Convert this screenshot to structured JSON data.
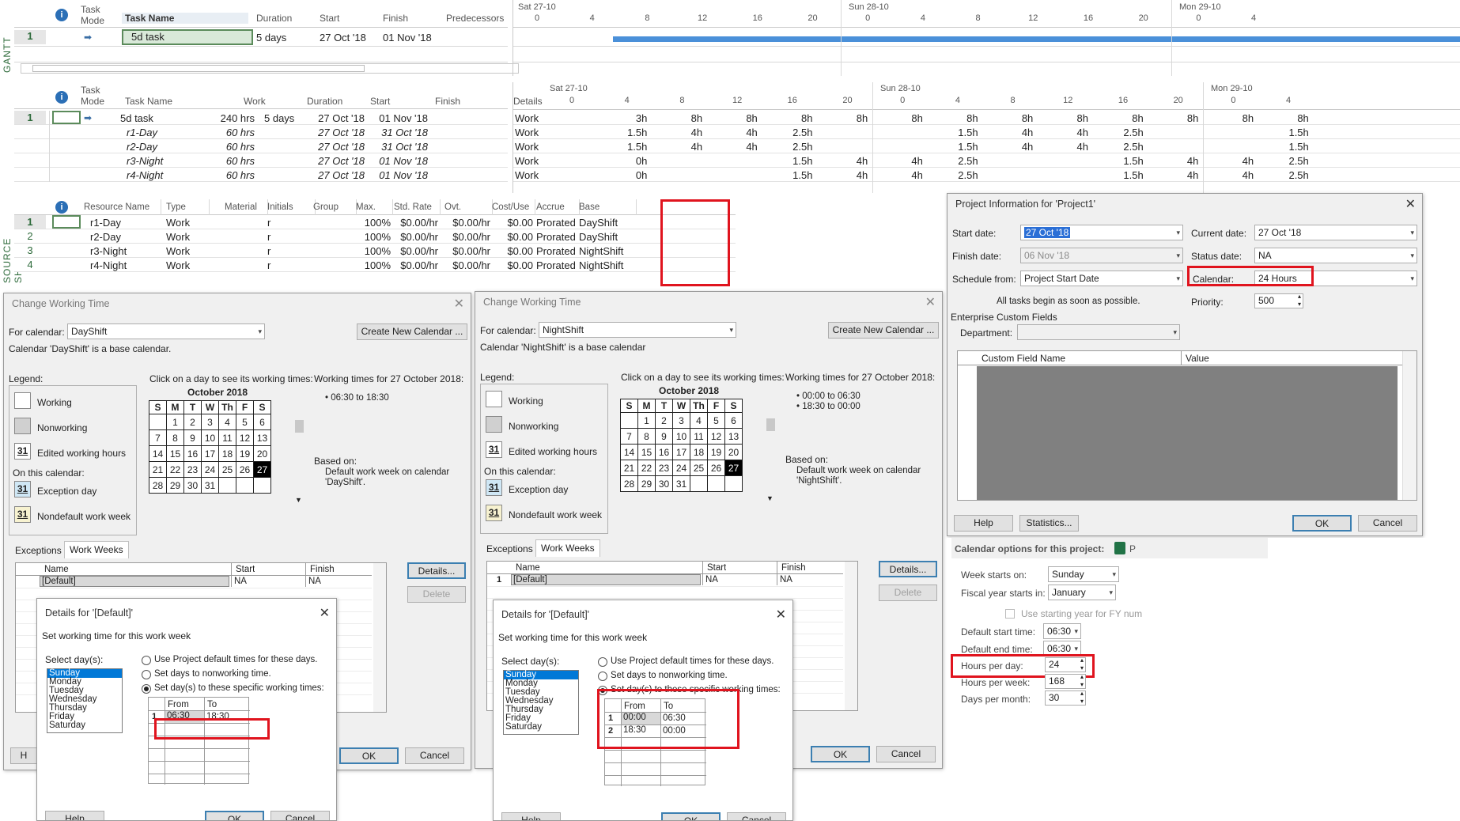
{
  "gantt": {
    "side_label": "GANTT CHART",
    "headers": [
      "Task Mode",
      "Task Name",
      "Duration",
      "Start",
      "Finish",
      "Predecessors"
    ],
    "row": {
      "num": "1",
      "name": "5d task",
      "duration": "5 days",
      "start": "27 Oct '18",
      "finish": "01 Nov '18"
    },
    "timescale_top": [
      "Sat 27-10",
      "Sun 28-10",
      "Mon 29-10"
    ],
    "timescale_ticks": [
      "0",
      "4",
      "8",
      "12",
      "16",
      "20",
      "0",
      "4",
      "8",
      "12",
      "16",
      "20",
      "0",
      "4"
    ]
  },
  "usage": {
    "headers": [
      "Task Mode",
      "Task Name",
      "Work",
      "Duration",
      "Start",
      "Finish"
    ],
    "details_label": "Details",
    "timescale_top": [
      "Sat 27-10",
      "Sun 28-10",
      "Mon 29-10"
    ],
    "timescale_ticks": [
      "0",
      "4",
      "8",
      "12",
      "16",
      "20",
      "0",
      "4",
      "8",
      "12",
      "16",
      "20",
      "0",
      "4"
    ],
    "rows": [
      {
        "num": "1",
        "name": "5d task",
        "work": "240 hrs",
        "duration": "5 days",
        "start": "27 Oct '18",
        "finish": "01 Nov '18",
        "detail": "Work",
        "values": [
          "",
          "3h",
          "8h",
          "8h",
          "8h",
          "8h",
          "8h",
          "8h",
          "8h",
          "8h",
          "8h",
          "8h",
          "8h",
          "8h"
        ]
      },
      {
        "num": "",
        "name": "r1-Day",
        "work": "60 hrs",
        "duration": "",
        "start": "27 Oct '18",
        "finish": "31 Oct '18",
        "detail": "Work",
        "values": [
          "",
          "1.5h",
          "4h",
          "4h",
          "2.5h",
          "",
          "",
          "1.5h",
          "4h",
          "4h",
          "2.5h",
          "",
          "",
          "1.5h"
        ]
      },
      {
        "num": "",
        "name": "r2-Day",
        "work": "60 hrs",
        "duration": "",
        "start": "27 Oct '18",
        "finish": "31 Oct '18",
        "detail": "Work",
        "values": [
          "",
          "1.5h",
          "4h",
          "4h",
          "2.5h",
          "",
          "",
          "1.5h",
          "4h",
          "4h",
          "2.5h",
          "",
          "",
          "1.5h"
        ]
      },
      {
        "num": "",
        "name": "r3-Night",
        "work": "60 hrs",
        "duration": "",
        "start": "27 Oct '18",
        "finish": "01 Nov '18",
        "detail": "Work",
        "values": [
          "",
          "0h",
          "",
          "",
          "1.5h",
          "4h",
          "4h",
          "2.5h",
          "",
          "",
          "1.5h",
          "4h",
          "4h",
          "2.5h"
        ]
      },
      {
        "num": "",
        "name": "r4-Night",
        "work": "60 hrs",
        "duration": "",
        "start": "27 Oct '18",
        "finish": "01 Nov '18",
        "detail": "Work",
        "values": [
          "",
          "0h",
          "",
          "",
          "1.5h",
          "4h",
          "4h",
          "2.5h",
          "",
          "",
          "1.5h",
          "4h",
          "4h",
          "2.5h"
        ]
      }
    ]
  },
  "resources": {
    "side_label": "SOURCE SHEET",
    "headers": [
      "Resource Name",
      "Type",
      "Material",
      "Initials",
      "Group",
      "Max.",
      "Std. Rate",
      "Ovt.",
      "Cost/Use",
      "Accrue",
      "Base"
    ],
    "rows": [
      {
        "num": "1",
        "name": "r1-Day",
        "type": "Work",
        "initials": "r",
        "max": "100%",
        "std": "$0.00/hr",
        "ovt": "$0.00/hr",
        "cost": "$0.00",
        "accrue": "Prorated",
        "base": "DayShift"
      },
      {
        "num": "2",
        "name": "r2-Day",
        "type": "Work",
        "initials": "r",
        "max": "100%",
        "std": "$0.00/hr",
        "ovt": "$0.00/hr",
        "cost": "$0.00",
        "accrue": "Prorated",
        "base": "DayShift"
      },
      {
        "num": "3",
        "name": "r3-Night",
        "type": "Work",
        "initials": "r",
        "max": "100%",
        "std": "$0.00/hr",
        "ovt": "$0.00/hr",
        "cost": "$0.00",
        "accrue": "Prorated",
        "base": "NightShift"
      },
      {
        "num": "4",
        "name": "r4-Night",
        "type": "Work",
        "initials": "r",
        "max": "100%",
        "std": "$0.00/hr",
        "ovt": "$0.00/hr",
        "cost": "$0.00",
        "accrue": "Prorated",
        "base": "NightShift"
      }
    ]
  },
  "cwt_common": {
    "title": "Change Working Time",
    "for_calendar_label": "For calendar:",
    "create_btn": "Create New Calendar ...",
    "legend_label": "Legend:",
    "click_label": "Click on a day to see its working times:",
    "working": "Working",
    "nonworking": "Nonworking",
    "edited": "Edited working hours",
    "on_this_cal": "On this calendar:",
    "exception_day": "Exception day",
    "nondefault": "Nondefault work week",
    "legend_num": "31",
    "month": "October 2018",
    "dow": [
      "S",
      "M",
      "T",
      "W",
      "Th",
      "F",
      "S"
    ],
    "weeks": [
      [
        "",
        "1",
        "2",
        "3",
        "4",
        "5",
        "6"
      ],
      [
        "7",
        "8",
        "9",
        "10",
        "11",
        "12",
        "13"
      ],
      [
        "14",
        "15",
        "16",
        "17",
        "18",
        "19",
        "20"
      ],
      [
        "21",
        "22",
        "23",
        "24",
        "25",
        "26",
        "27"
      ],
      [
        "28",
        "29",
        "30",
        "31",
        "",
        "",
        ""
      ]
    ],
    "working_times_label": "Working times for 27 October 2018:",
    "based_on": "Based on:",
    "tab_exceptions": "Exceptions",
    "tab_work_weeks": "Work Weeks",
    "col_name": "Name",
    "col_start": "Start",
    "col_finish": "Finish",
    "row_name": "[Default]",
    "row_start": "NA",
    "row_finish": "NA",
    "details_btn": "Details...",
    "delete_btn": "Delete",
    "ok": "OK",
    "cancel": "Cancel"
  },
  "cwt_day": {
    "calendar": "DayShift",
    "base_note": "Calendar 'DayShift' is a base calendar.",
    "times": [
      "• 06:30 to 18:30"
    ],
    "based_on_text": "Default work week on calendar 'DayShift'.",
    "row_num": "",
    "help_stub": "H"
  },
  "cwt_night": {
    "calendar": "NightShift",
    "base_note": "Calendar 'NightShift' is a base calendar",
    "times": [
      "• 00:00 to 06:30",
      "• 18:30 to 00:00"
    ],
    "based_on_text": "Default work week on calendar 'NightShift'.",
    "row_num": "1"
  },
  "details_common": {
    "title": "Details for '[Default]'",
    "subtitle": "Set working time for this work week",
    "select_days": "Select day(s):",
    "days": [
      "Sunday",
      "Monday",
      "Tuesday",
      "Wednesday",
      "Thursday",
      "Friday",
      "Saturday"
    ],
    "opt1": "Use Project default times for these days.",
    "opt2": "Set days to nonworking time.",
    "opt3": "Set day(s) to these specific working times:",
    "col_from": "From",
    "col_to": "To",
    "help": "Help",
    "ok": "OK",
    "cancel": "Cancel"
  },
  "details_day": {
    "rows": [
      {
        "n": "1",
        "from": "06:30",
        "to": "18:30"
      }
    ]
  },
  "details_night": {
    "rows": [
      {
        "n": "1",
        "from": "00:00",
        "to": "06:30"
      },
      {
        "n": "2",
        "from": "18:30",
        "to": "00:00"
      }
    ]
  },
  "project_info": {
    "title": "Project Information for 'Project1'",
    "start_date_label": "Start date:",
    "start_date": "27 Oct '18",
    "finish_date_label": "Finish date:",
    "finish_date": "06 Nov '18",
    "schedule_from_label": "Schedule from:",
    "schedule_from": "Project Start Date",
    "asap_note": "All tasks begin as soon as possible.",
    "current_date_label": "Current date:",
    "current_date": "27 Oct '18",
    "status_date_label": "Status date:",
    "status_date": "NA",
    "calendar_label": "Calendar:",
    "calendar": "24 Hours",
    "priority_label": "Priority:",
    "priority": "500",
    "ecf_label": "Enterprise Custom Fields",
    "department_label": "Department:",
    "col_custom": "Custom Field Name",
    "col_value": "Value",
    "help": "Help",
    "statistics": "Statistics...",
    "ok": "OK",
    "cancel": "Cancel"
  },
  "cal_options": {
    "heading": "Calendar options for this project:",
    "project_label": "P",
    "week_starts_label": "Week starts on:",
    "week_starts": "Sunday",
    "fiscal_label": "Fiscal year starts in:",
    "fiscal": "January",
    "use_starting_year": "Use starting year for FY num",
    "default_start_label": "Default start time:",
    "default_start": "06:30",
    "default_end_label": "Default end time:",
    "default_end": "06:30",
    "hours_day_label": "Hours per day:",
    "hours_day": "24",
    "hours_week_label": "Hours per week:",
    "hours_week": "168",
    "days_month_label": "Days per month:",
    "days_month": "30"
  }
}
